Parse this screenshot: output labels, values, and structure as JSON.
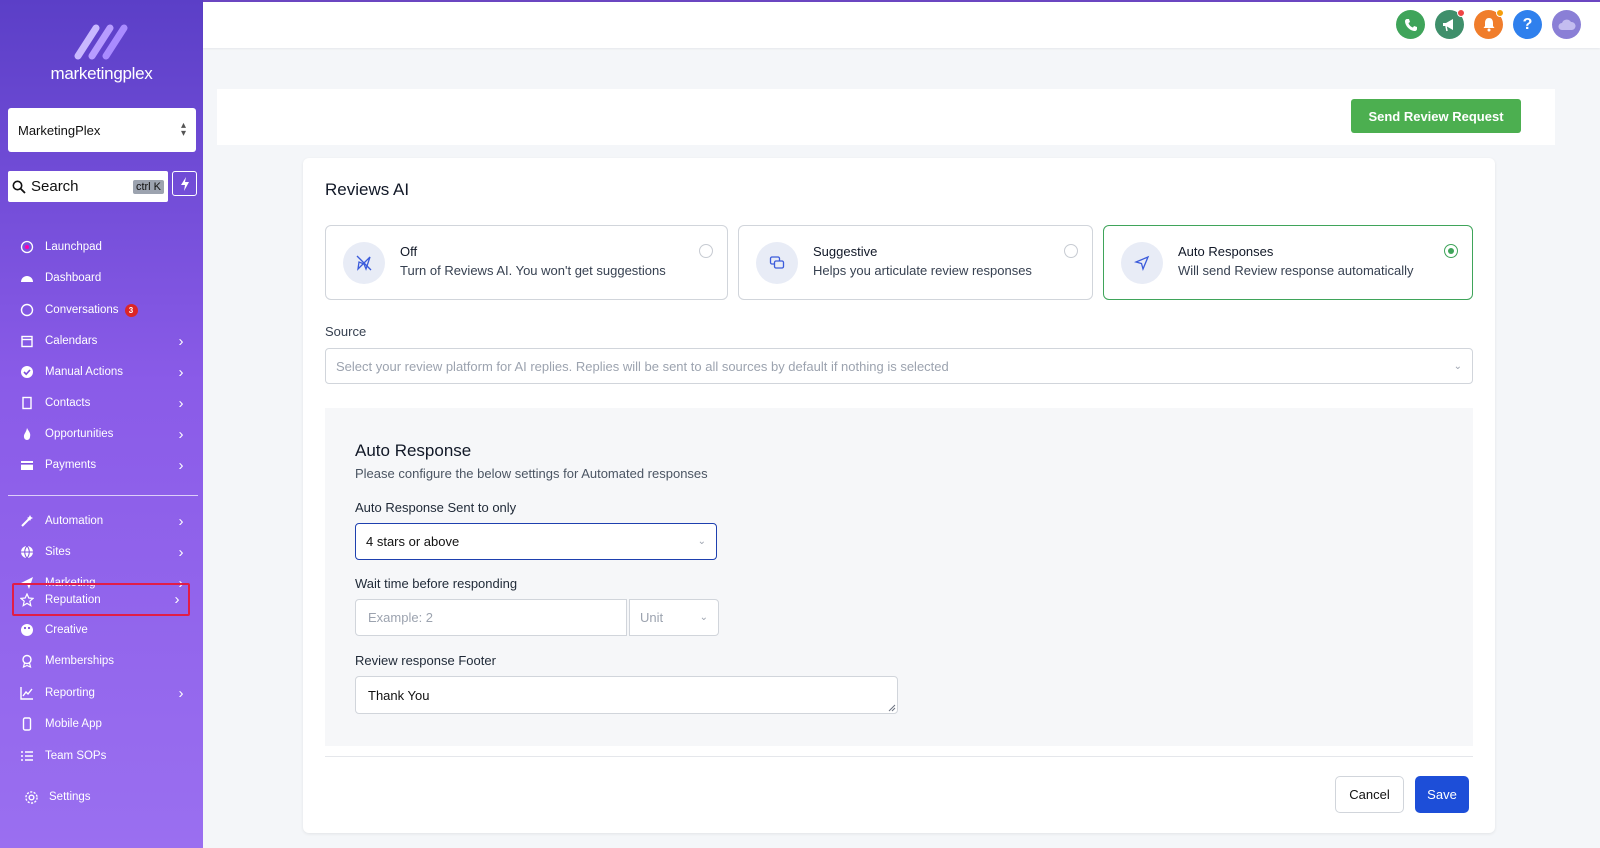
{
  "brand": {
    "name": "marketingplex"
  },
  "sidebar": {
    "account": "MarketingPlex",
    "search": {
      "label": "Search",
      "shortcut": "ctrl K"
    },
    "conversations_badge": "3",
    "items": [
      {
        "label": "Launchpad",
        "icon": "rocket-icon"
      },
      {
        "label": "Dashboard",
        "icon": "gauge-icon"
      },
      {
        "label": "Conversations",
        "icon": "chat-icon"
      },
      {
        "label": "Calendars",
        "icon": "calendar-icon"
      },
      {
        "label": "Manual Actions",
        "icon": "check-circle-icon"
      },
      {
        "label": "Contacts",
        "icon": "contacts-icon"
      },
      {
        "label": "Opportunities",
        "icon": "flame-icon"
      },
      {
        "label": "Payments",
        "icon": "card-icon"
      },
      {
        "label": "Automation",
        "icon": "wand-icon"
      },
      {
        "label": "Sites",
        "icon": "globe-icon"
      },
      {
        "label": "Marketing",
        "icon": "send-icon"
      },
      {
        "label": "Reputation",
        "icon": "star-icon"
      },
      {
        "label": "Creative",
        "icon": "palette-icon"
      },
      {
        "label": "Memberships",
        "icon": "award-icon"
      },
      {
        "label": "Reporting",
        "icon": "chart-icon"
      },
      {
        "label": "Mobile App",
        "icon": "phone-icon"
      },
      {
        "label": "Team SOPs",
        "icon": "list-icon"
      },
      {
        "label": "Settings",
        "icon": "gear-icon"
      }
    ]
  },
  "header": {
    "send_review_request": "Send Review Request"
  },
  "reviews_ai": {
    "title": "Reviews AI",
    "options": [
      {
        "title": "Off",
        "desc": "Turn of Reviews AI. You won't get suggestions",
        "selected": false
      },
      {
        "title": "Suggestive",
        "desc": "Helps you articulate review responses",
        "selected": false
      },
      {
        "title": "Auto Responses",
        "desc": "Will send Review response automatically",
        "selected": true
      }
    ],
    "source_label": "Source",
    "source_placeholder": "Select your review platform for AI replies. Replies will be sent to all sources by default if nothing is selected"
  },
  "auto_response": {
    "title": "Auto Response",
    "subtitle": "Please configure the below settings for Automated responses",
    "sent_to_label": "Auto Response Sent to only",
    "sent_to_value": "4 stars or above",
    "wait_label": "Wait time before responding",
    "wait_placeholder": "Example: 2",
    "unit_placeholder": "Unit",
    "footer_label": "Review response Footer",
    "footer_value": "Thank You"
  },
  "actions": {
    "cancel": "Cancel",
    "save": "Save"
  },
  "colors": {
    "accent_green": "#4caf50",
    "primary_blue": "#1d4ed8",
    "sidebar_purple": "#7c4ddb"
  }
}
